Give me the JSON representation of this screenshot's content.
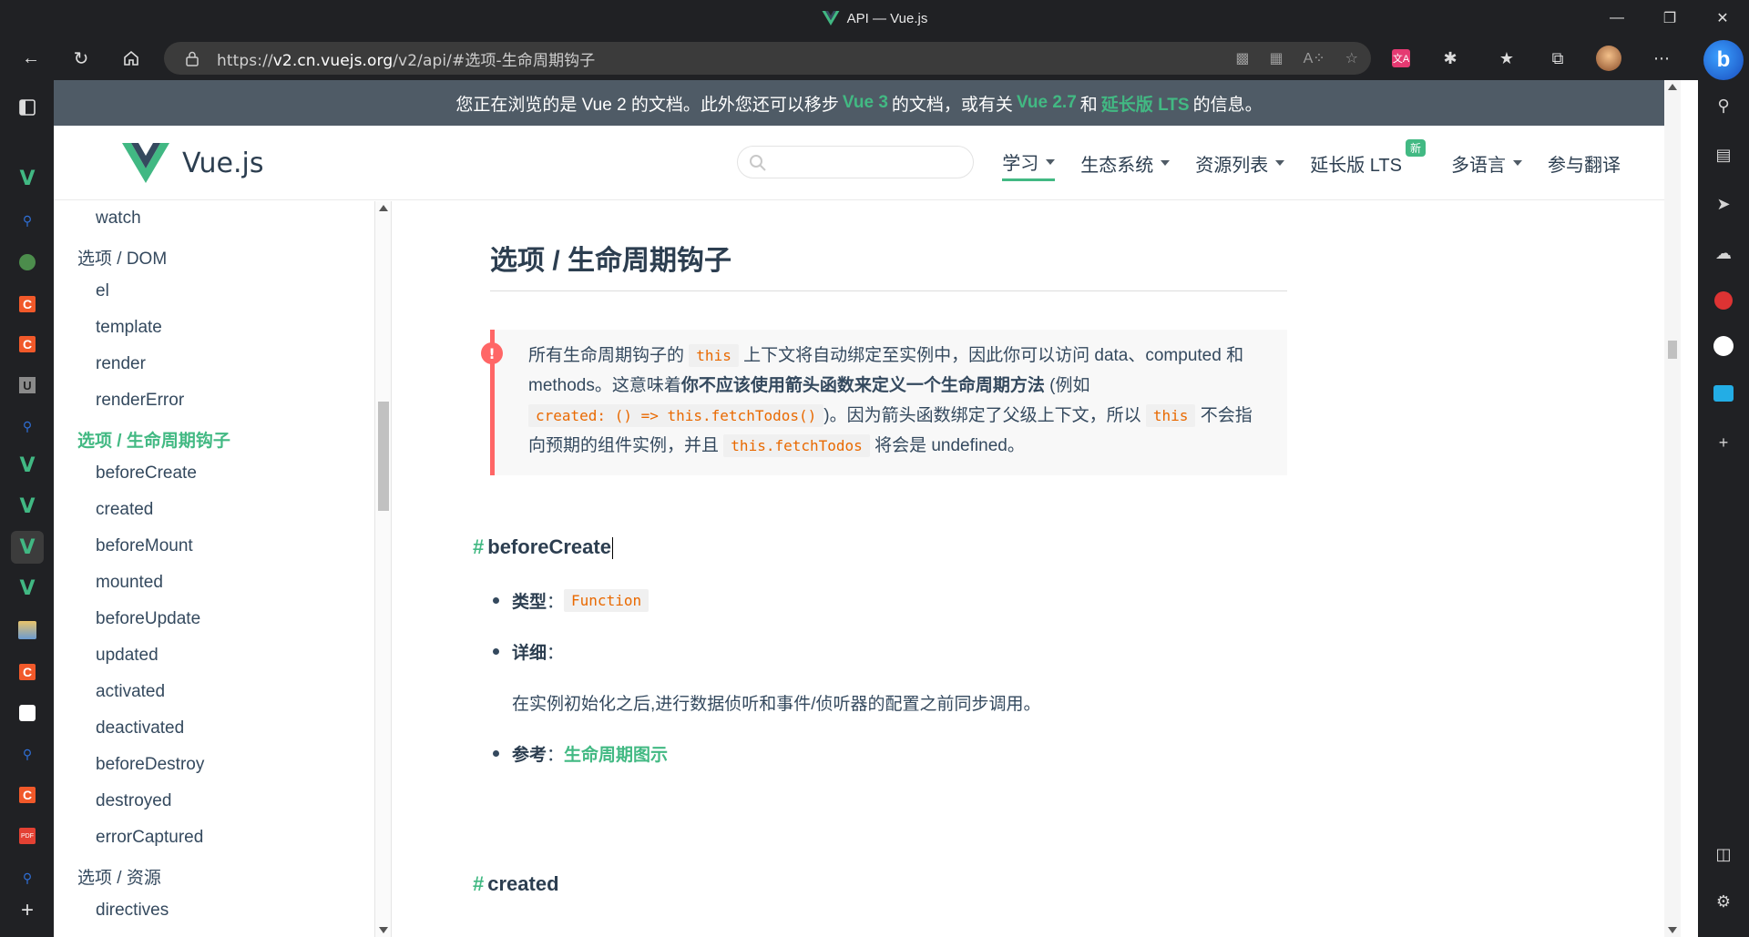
{
  "window": {
    "title": "API — Vue.js",
    "controls": [
      "minimize",
      "restore",
      "close"
    ]
  },
  "toolbar": {
    "url_prefix": "https://",
    "url_host": "v2.cn.vuejs.org",
    "url_path": "/v2/api/#选项-生命周期钩子",
    "address_icons": [
      "app-available-icon",
      "qr-code-icon",
      "read-aloud-icon",
      "add-favorite-icon"
    ],
    "extensions": [
      "translate-extension-icon",
      "extensions-icon",
      "favorites-icon",
      "collections-icon",
      "profile-avatar",
      "more-icon"
    ]
  },
  "banner": {
    "part1": "您正在浏览的是 Vue 2 的文档。此外您还可以移步",
    "link1": "Vue 3",
    "part2": "的文档，或有关",
    "link2": "Vue 2.7",
    "part3": "和",
    "link3": "延长版 LTS",
    "part4": "的信息。"
  },
  "header": {
    "brand": "Vue.js",
    "nav": [
      {
        "label": "学习",
        "caret": true,
        "active": true
      },
      {
        "label": "生态系统",
        "caret": true
      },
      {
        "label": "资源列表",
        "caret": true
      },
      {
        "label": "延长版 LTS",
        "badge": "新"
      },
      {
        "label": "多语言",
        "caret": true
      },
      {
        "label": "参与翻译"
      }
    ]
  },
  "sidebar": {
    "items": [
      {
        "label": "watch",
        "level": "sub"
      },
      {
        "label": "选项 / DOM",
        "level": "sec"
      },
      {
        "label": "el",
        "level": "sub"
      },
      {
        "label": "template",
        "level": "sub"
      },
      {
        "label": "render",
        "level": "sub"
      },
      {
        "label": "renderError",
        "level": "sub"
      },
      {
        "label": "选项 / 生命周期钩子",
        "level": "sec",
        "current": true
      },
      {
        "label": "beforeCreate",
        "level": "sub"
      },
      {
        "label": "created",
        "level": "sub"
      },
      {
        "label": "beforeMount",
        "level": "sub"
      },
      {
        "label": "mounted",
        "level": "sub"
      },
      {
        "label": "beforeUpdate",
        "level": "sub"
      },
      {
        "label": "updated",
        "level": "sub"
      },
      {
        "label": "activated",
        "level": "sub"
      },
      {
        "label": "deactivated",
        "level": "sub"
      },
      {
        "label": "beforeDestroy",
        "level": "sub"
      },
      {
        "label": "destroyed",
        "level": "sub"
      },
      {
        "label": "errorCaptured",
        "level": "sub"
      },
      {
        "label": "选项 / 资源",
        "level": "sec"
      },
      {
        "label": "directives",
        "level": "sub"
      }
    ]
  },
  "content": {
    "heading": "选项 / 生命周期钩子",
    "tip": {
      "t1": "所有生命周期钩子的",
      "c1": "this",
      "t2": "上下文将自动绑定至实例中，因此你可以访问 data、computed 和 methods。这意味着",
      "strong": "你不应该使用箭头函数来定义一个生命周期方法",
      "t3": "(例如",
      "c2": "created: () => this.fetchTodos()",
      "t4": ")。因为箭头函数绑定了父级上下文，所以",
      "c3": "this",
      "t5": "不会指向预期的组件实例，并且",
      "c4": "this.fetchTodos",
      "t6": "将会是 undefined。"
    },
    "section1": {
      "hash": "#",
      "title": "beforeCreate",
      "type_label": "类型",
      "type_value": "Function",
      "detail_label": "详细",
      "detail_text": "在实例初始化之后,进行数据侦听和事件/侦听器的配置之前同步调用。",
      "see_label": "参考",
      "see_link": "生命周期图示"
    },
    "section2": {
      "hash": "#",
      "title": "created"
    },
    "colon": "："
  },
  "colors": {
    "accent": "#42b983",
    "banner_bg": "#4f5b66",
    "text": "#2c3e50",
    "warning": "#ff6666",
    "code": "#e96900"
  }
}
